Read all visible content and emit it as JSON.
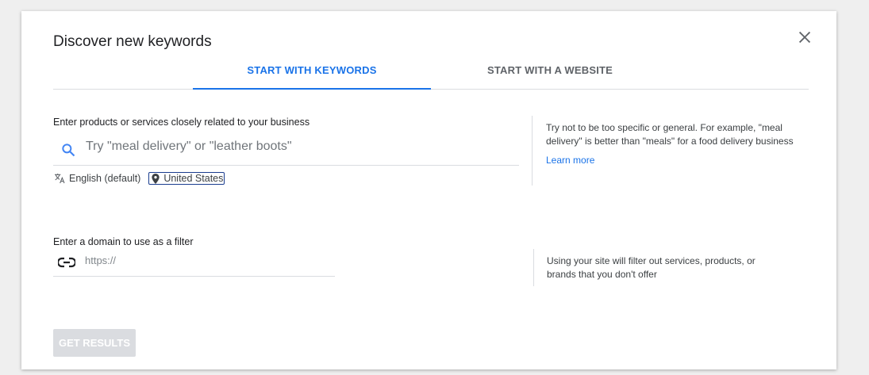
{
  "dialog": {
    "title": "Discover new keywords"
  },
  "tabs": [
    {
      "label": "START WITH KEYWORDS",
      "active": true
    },
    {
      "label": "START WITH A WEBSITE",
      "active": false
    }
  ],
  "keywords": {
    "label": "Enter products or services closely related to your business",
    "placeholder": "Try \"meal delivery\" or \"leather boots\"",
    "language": "English (default)",
    "location": "United States",
    "help": "Try not to be too specific or general. For example, \"meal delivery\" is better than \"meals\" for a food delivery business",
    "learn_more": "Learn more"
  },
  "domain": {
    "label": "Enter a domain to use as a filter",
    "placeholder": "https://",
    "help": "Using your site will filter out services, products, or brands that you don't offer"
  },
  "actions": {
    "get_results": "GET RESULTS"
  },
  "colors": {
    "accent": "#1a73e8",
    "disabled": "#dadce0"
  }
}
